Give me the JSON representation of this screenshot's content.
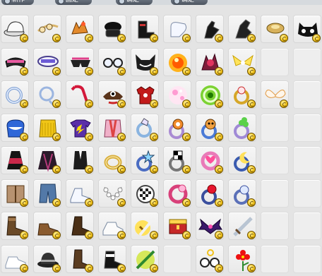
{
  "tabs": [
    {
      "label": "新作",
      "active": true
    },
    {
      "label": "固定",
      "active": false
    },
    {
      "label": "确定",
      "active": false
    },
    {
      "label": "确定",
      "active": false
    }
  ],
  "grid": {
    "rows": 8,
    "cols": 10,
    "items": [
      [
        "white-cap",
        "goggles-headband",
        "orange-fox-hat",
        "black-beret",
        "black-boots",
        "white-gloves",
        "black-glove",
        "black-gauntlet",
        "gold-earring",
        "black-cat-mask"
      ],
      [
        "pink-black-visor",
        "purple-glasses",
        "pink-black-shades",
        "round-glasses",
        "black-cat-face",
        "fire-orb",
        "red-crystal-cluster",
        "yellow-spark-wings",
        "",
        ""
      ],
      [
        "silver-ring",
        "silver-hoop",
        "red-cane",
        "brown-pirate-hat",
        "red-flower-shirt",
        "pink-sparkle-ring",
        "green-glowing-ring",
        "gold-jewel-ring",
        "white-wings",
        ""
      ],
      [
        "blue-cloud-outfit",
        "yellow-raincoat",
        "purple-tshirt",
        "pink-kimono",
        "crystal-ring",
        "character-ring-orange",
        "character-ring-face",
        "clover-ring",
        "",
        ""
      ],
      [
        "red-black-dress",
        "dark-robe",
        "black-suit",
        "gold-bracelet",
        "blue-star-ring",
        "checkered-ring",
        "pink-heart-ring",
        "moon-ring",
        "",
        ""
      ],
      [
        "brown-coat",
        "denim-jeans",
        "white-shoes",
        "pearl-necklace",
        "checkered-flag-ring",
        "pink-glow-ring",
        "red-orb-ring",
        "blue-white-ring",
        "",
        ""
      ],
      [
        "brown-boots",
        "brown-shoes",
        "dark-brown-boots",
        "white-sneakers",
        "golden-sword",
        "treasure-box",
        "purple-bat-wings",
        "steel-sword",
        "",
        ""
      ],
      [
        "white-shoes-2",
        "black-fedora",
        "brown-tall-boots",
        "black-hightops",
        "green-weapon",
        "",
        "round-spectacles",
        "red-flower",
        "",
        ""
      ]
    ]
  }
}
